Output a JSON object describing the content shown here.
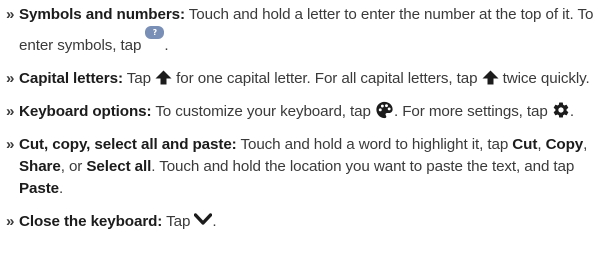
{
  "bullet_glyph": "»",
  "items": [
    {
      "title": "Symbols and numbers:",
      "text1": " Touch and hold a letter to enter the number at the top of it. To enter symbols, tap ",
      "text2": ".",
      "icon": "symbols-key-icon",
      "icon_text": "?123"
    },
    {
      "title": "Capital letters:",
      "text1": " Tap ",
      "text2": " for one capital letter. For all capital letters, tap ",
      "text3": " twice quickly.",
      "icon": "shift-arrow-icon"
    },
    {
      "title": "Keyboard options:",
      "text1": " To customize your keyboard, tap ",
      "text2": ". For more settings, tap ",
      "text3": ".",
      "icons": [
        "palette-icon",
        "gear-icon"
      ]
    },
    {
      "title": "Cut, copy, select all and paste:",
      "text1": " Touch and hold a word to highlight it, tap ",
      "cut": "Cut",
      "sep1": ", ",
      "copy": "Copy",
      "sep2": ", ",
      "share": "Share",
      "sep3": ", or ",
      "select_all": "Select all",
      "text2": ". Touch and hold the location you want to paste the text, and tap ",
      "paste": "Paste",
      "text3": "."
    },
    {
      "title": "Close the keyboard:",
      "text1": " Tap ",
      "text2": ".",
      "icon": "chevron-down-icon"
    }
  ],
  "colors": {
    "text": "#3a3a3a",
    "bold": "#1c1c1c",
    "symbol_key": "#7a8fb5"
  }
}
